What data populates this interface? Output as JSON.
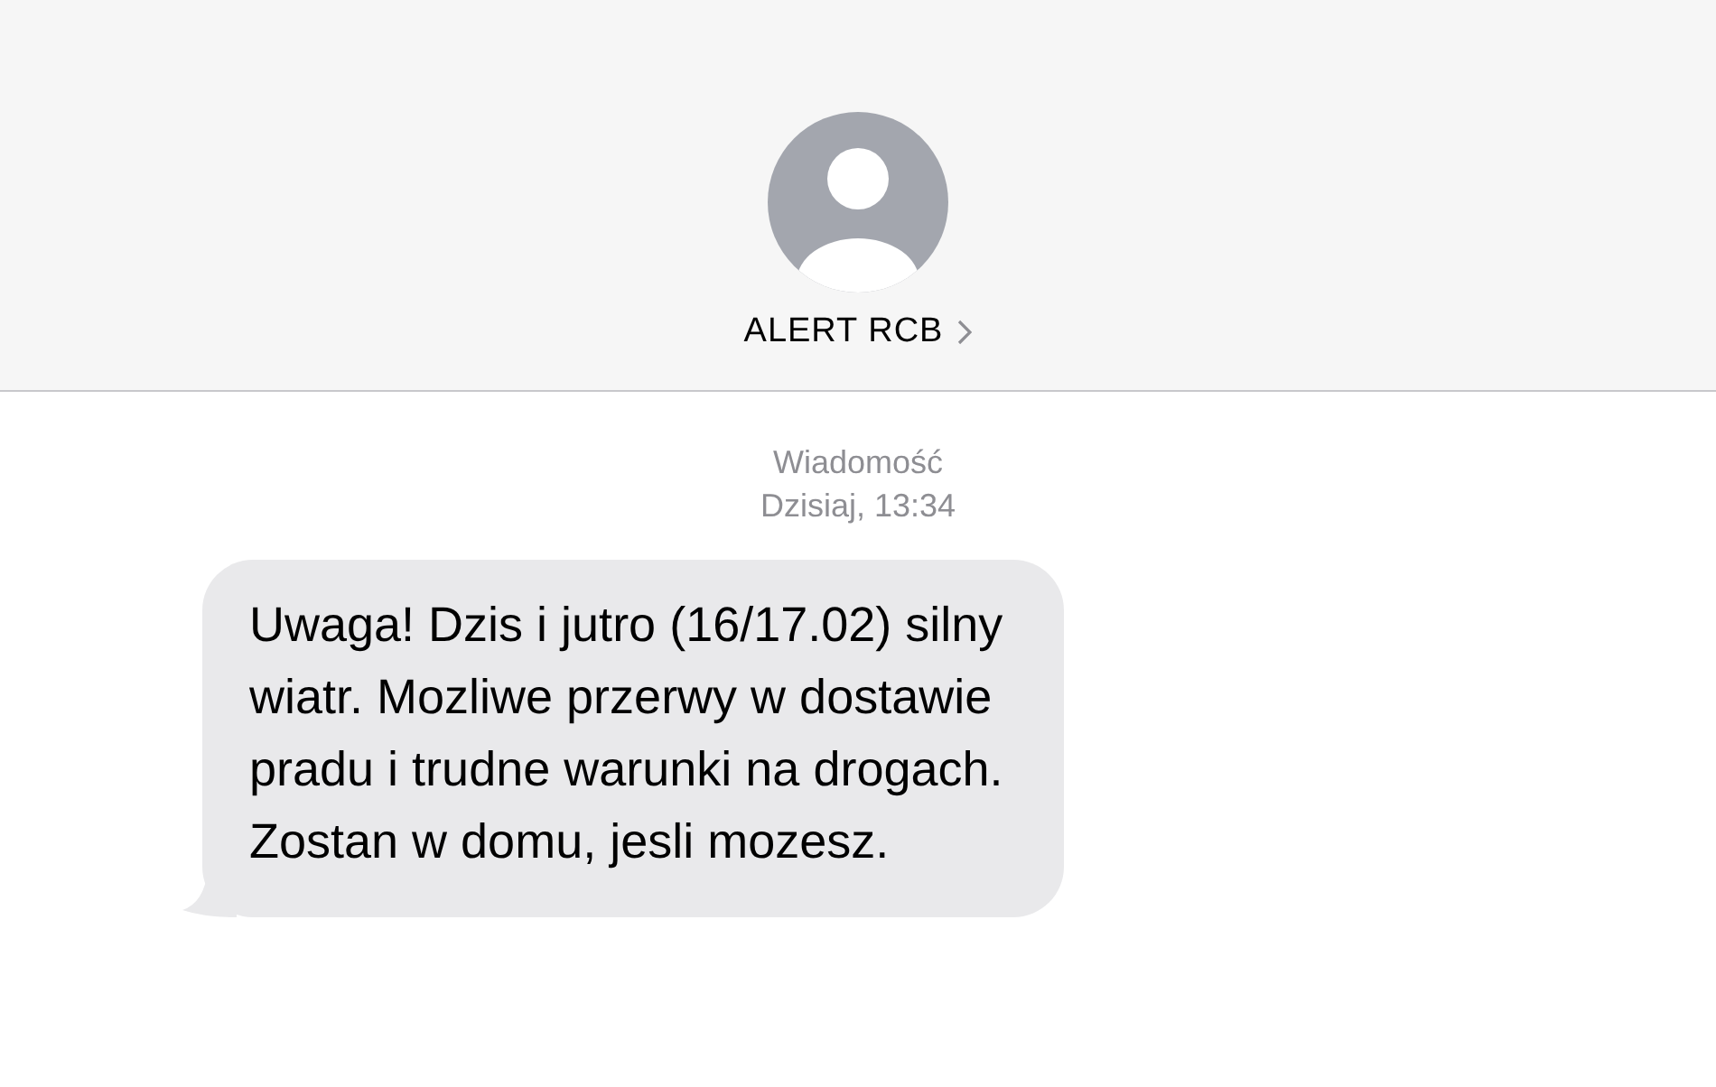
{
  "contact": {
    "name": "ALERT RCB"
  },
  "thread": {
    "label": "Wiadomość",
    "timestamp": "Dzisiaj, 13:34"
  },
  "messages": [
    {
      "kind": "incoming",
      "lines": [
        "Uwaga! Dzis i jutro (16/17.02) silny",
        "wiatr. Mozliwe przerwy w dostawie",
        "pradu i trudne warunki na drogach.",
        "Zostan w domu, jesli mozesz."
      ]
    }
  ]
}
